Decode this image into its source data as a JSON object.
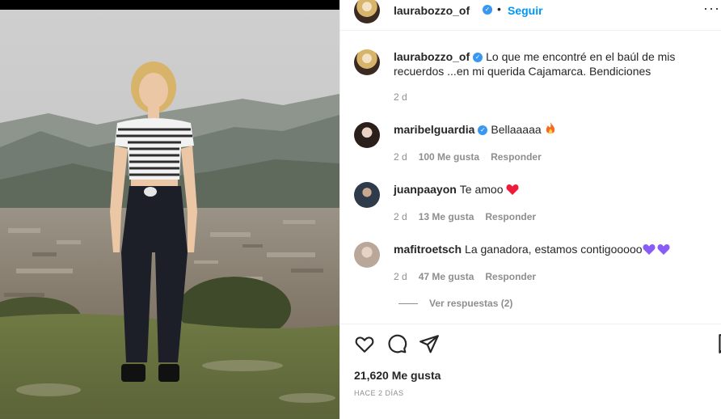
{
  "post": {
    "author": "laurabozzo_of",
    "follow_label": "Seguir",
    "separator": "•",
    "more_label": "···",
    "caption": "Lo que me encontré en el baúl de mis recuerdos ...en mi querida Cajamarca. Bendiciones",
    "caption_time": "2 d",
    "likes": "21,620 Me gusta",
    "posted_ago": "HACE 2 DÍAS"
  },
  "comments": [
    {
      "user": "maribelguardia",
      "verified": true,
      "text": "Bellaaaaa",
      "emoji": "fire",
      "time": "2 d",
      "likes": "100 Me gusta",
      "reply": "Responder"
    },
    {
      "user": "juanpaayon",
      "verified": false,
      "text": "Te amoo",
      "emoji": "red-heart",
      "time": "2 d",
      "likes": "13 Me gusta",
      "reply": "Responder"
    },
    {
      "user": "mafitroetsch",
      "verified": false,
      "text": "La ganadora, estamos contigooooo",
      "emoji": "purple-hearts",
      "time": "2 d",
      "likes": "47 Me gusta",
      "reply": "Responder"
    }
  ],
  "view_replies": "Ver respuestas (2)",
  "icons": {
    "verified": "verified-badge-icon",
    "like": "heart-outline-icon",
    "comment": "speech-bubble-icon",
    "share": "paper-plane-icon",
    "save": "bookmark-icon"
  },
  "colors": {
    "accent": "#0095f6",
    "verified": "#3897f0",
    "muted": "#8e8e8e",
    "heart_red": "#ed1c3a",
    "heart_purple": "#8a5cf6"
  }
}
